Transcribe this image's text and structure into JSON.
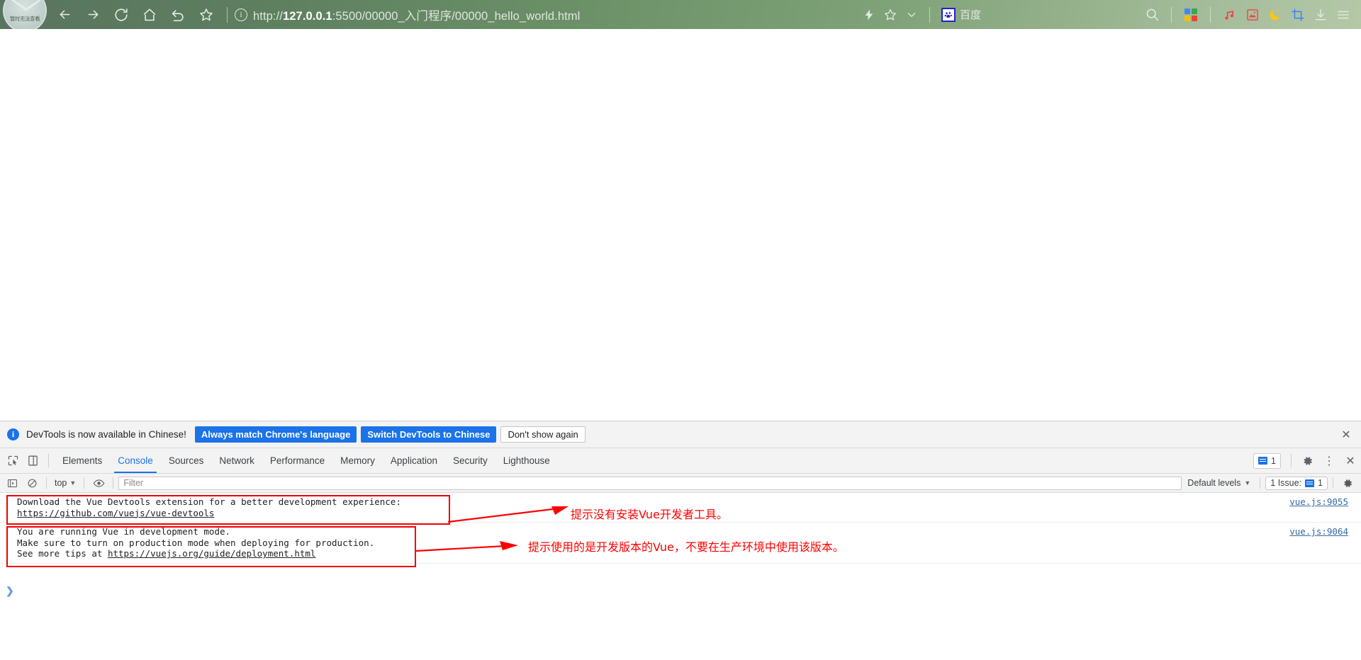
{
  "browser": {
    "avatar_label": "暂时无法查看",
    "nav": [
      {
        "name": "back-button",
        "glyph": "←"
      },
      {
        "name": "forward-button",
        "glyph": "→"
      },
      {
        "name": "reload-button",
        "glyph": "⟳"
      },
      {
        "name": "home-button",
        "glyph": "⌂"
      },
      {
        "name": "undo-button",
        "glyph": "↺"
      },
      {
        "name": "bookmark-star-button",
        "glyph": "☆"
      }
    ],
    "url": {
      "scheme": "http://",
      "host": "127.0.0.1",
      "rest": ":5500/00000_入门程序/00000_hello_world.html",
      "full": "http://127.0.0.1:5500/00000_入门程序/00000_hello_world.html"
    },
    "baidu_label": "百度",
    "right_icons": [
      {
        "name": "lightning-icon",
        "glyph": "⚡"
      },
      {
        "name": "favorite-star-icon",
        "glyph": "☆"
      },
      {
        "name": "chevron-down-icon",
        "glyph": "⌄"
      },
      {
        "name": "search-icon",
        "glyph": "🔍"
      },
      {
        "name": "apps-grid-icon",
        "glyph": "▦"
      },
      {
        "name": "music-note-icon",
        "glyph": "♫"
      },
      {
        "name": "pdf-reader-icon",
        "glyph": "⛰"
      },
      {
        "name": "night-mode-moon-icon",
        "glyph": "☾"
      },
      {
        "name": "screenshot-crop-icon",
        "glyph": "⌗"
      },
      {
        "name": "download-icon",
        "glyph": "↓"
      },
      {
        "name": "menu-hamburger-icon",
        "glyph": "☰"
      }
    ],
    "colors": {
      "grid_blue": "#4285f4",
      "grid_green": "#34a853",
      "grid_yellow": "#fbbc05",
      "grid_red": "#ea4335",
      "music_red": "#f1404b",
      "pdf_red": "#f1404b",
      "moon_yellow": "#fcc419",
      "crop_blue": "#3b82f6"
    }
  },
  "devtools": {
    "infobar": {
      "message": "DevTools is now available in Chinese!",
      "btn_always_match": "Always match Chrome's language",
      "btn_switch": "Switch DevTools to Chinese",
      "btn_dont_show": "Don't show again",
      "close_glyph": "✕"
    },
    "tabs": [
      {
        "label": "Elements",
        "active": false
      },
      {
        "label": "Console",
        "active": true
      },
      {
        "label": "Sources",
        "active": false
      },
      {
        "label": "Network",
        "active": false
      },
      {
        "label": "Performance",
        "active": false
      },
      {
        "label": "Memory",
        "active": false
      },
      {
        "label": "Application",
        "active": false
      },
      {
        "label": "Security",
        "active": false
      },
      {
        "label": "Lighthouse",
        "active": false
      }
    ],
    "tabbar_right": {
      "message_count": "1",
      "gear_glyph": "⚙",
      "more_glyph": "⋮",
      "close_glyph": "✕"
    },
    "console_toolbar": {
      "context": "top",
      "filter_placeholder": "Filter",
      "levels": "Default levels",
      "issue_label": "1 Issue:",
      "issue_count": "1",
      "caret": "▼"
    },
    "logs": [
      {
        "lines": [
          {
            "text": "Download the Vue Devtools extension for a better development experience:",
            "link": false
          },
          {
            "text": "https://github.com/vuejs/vue-devtools",
            "link": true
          }
        ],
        "source": "vue.js:9055",
        "annotation": "提示没有安装Vue开发者工具。"
      },
      {
        "lines": [
          {
            "text": "You are running Vue in development mode.",
            "link": false
          },
          {
            "text": "Make sure to turn on production mode when deploying for production.",
            "link": false
          },
          {
            "text": "See more tips at ",
            "link": false,
            "tail_link": "https://vuejs.org/guide/deployment.html"
          }
        ],
        "source": "vue.js:9064",
        "annotation": "提示使用的是开发版本的Vue，不要在生产环境中使用该版本。"
      }
    ],
    "prompt_glyph": "❯",
    "annotation_color": "#ff0000",
    "highlight_box_color": "#ee0000"
  }
}
